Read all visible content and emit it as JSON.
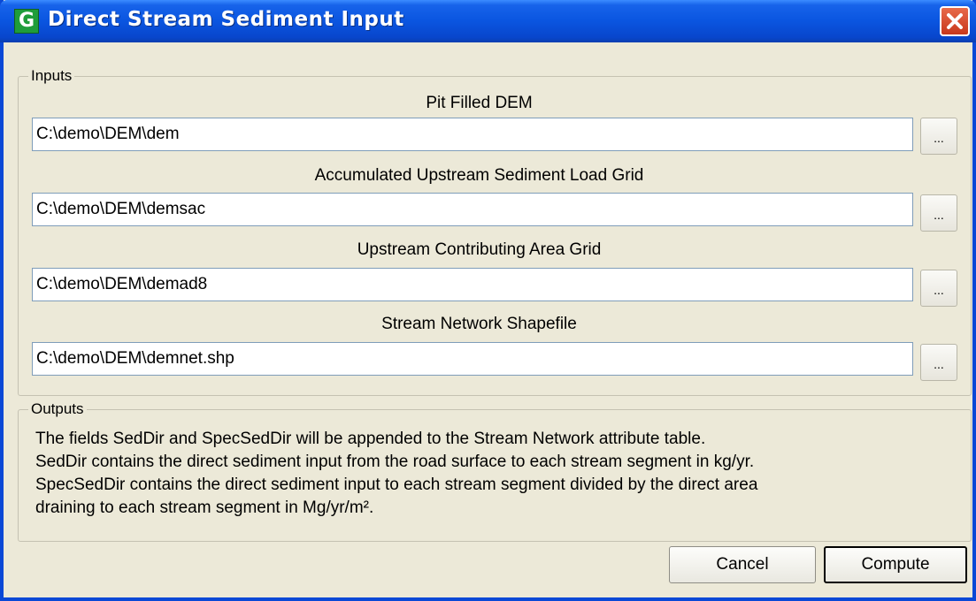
{
  "window": {
    "icon_letter": "G",
    "title": "Direct Stream Sediment Input"
  },
  "inputs_group": {
    "legend": "Inputs",
    "fields": [
      {
        "label": "Pit Filled DEM",
        "value": "C:\\demo\\DEM\\dem",
        "browse": "..."
      },
      {
        "label": "Accumulated Upstream Sediment Load Grid",
        "value": "C:\\demo\\DEM\\demsac",
        "browse": "..."
      },
      {
        "label": "Upstream Contributing Area Grid",
        "value": "C:\\demo\\DEM\\demad8",
        "browse": "..."
      },
      {
        "label": "Stream Network Shapefile",
        "value": "C:\\demo\\DEM\\demnet.shp",
        "browse": "..."
      }
    ]
  },
  "outputs_group": {
    "legend": "Outputs",
    "lines": [
      "The fields SedDir and SpecSedDir will be appended to the Stream Network attribute table.",
      "SedDir contains the direct sediment input from the road surface to each stream segment in kg/yr.",
      "SpecSedDir contains the direct sediment input to each stream segment divided by the direct area",
      "draining to each stream segment in Mg/yr/m²."
    ]
  },
  "buttons": {
    "cancel": "Cancel",
    "compute": "Compute"
  },
  "colors": {
    "titlebar": "#0a55e0",
    "close": "#c8381c",
    "face": "#ece9d8"
  }
}
